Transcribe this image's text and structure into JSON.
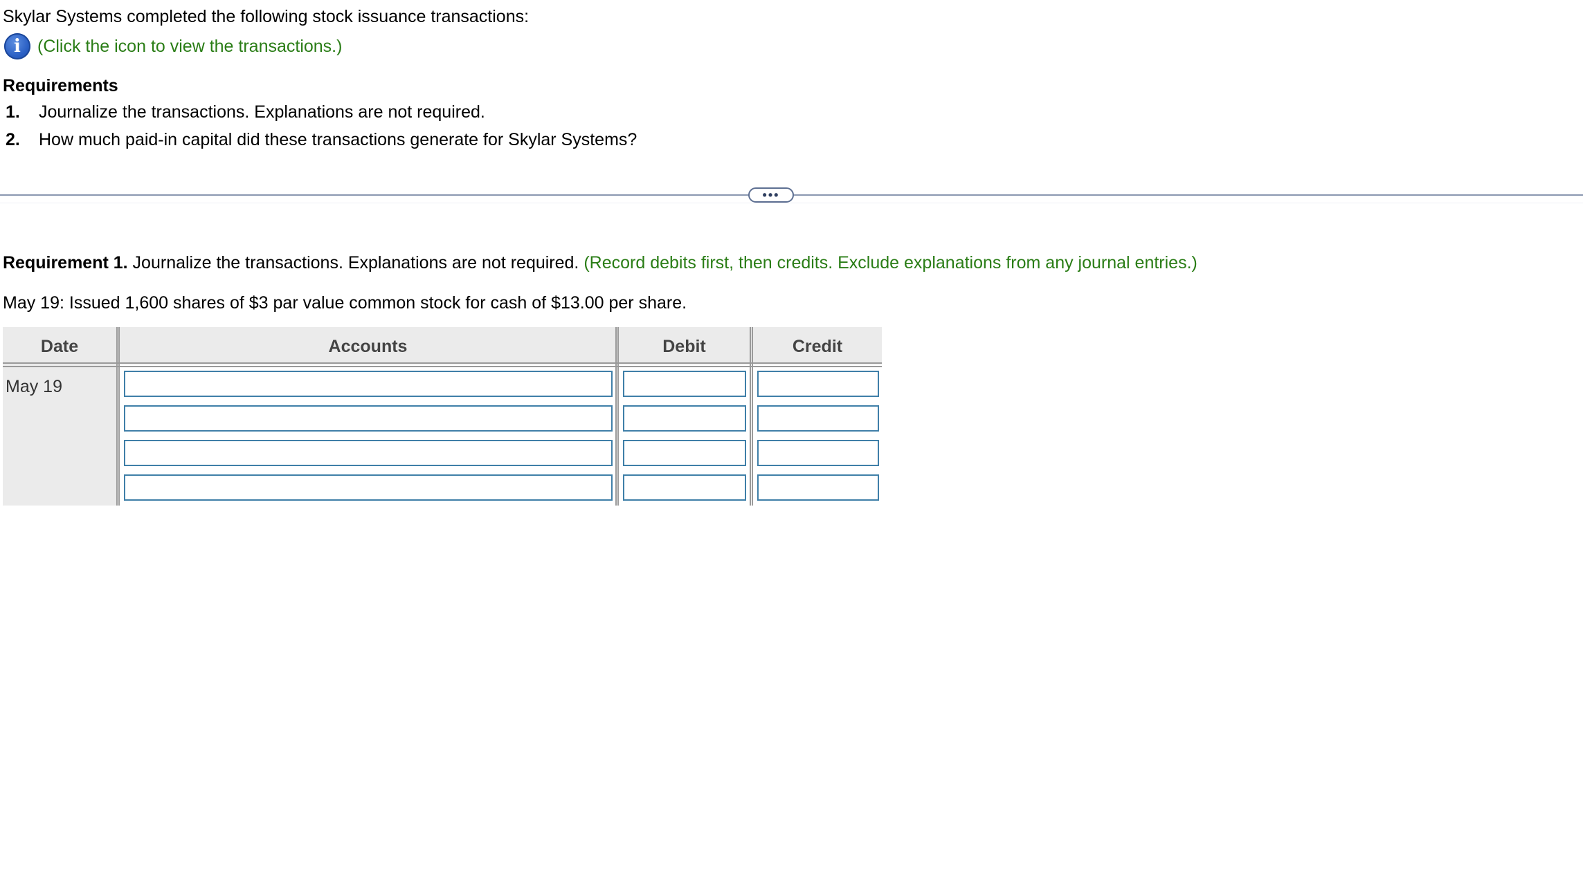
{
  "intro": {
    "text": "Skylar Systems completed the following stock issuance transactions:",
    "link_text": "(Click the icon to view the transactions.)"
  },
  "requirements": {
    "title": "Requirements",
    "items": [
      {
        "num": "1.",
        "text": "Journalize the transactions. Explanations are not required."
      },
      {
        "num": "2.",
        "text": "How much paid-in capital did these transactions generate for Skylar Systems?"
      }
    ]
  },
  "expand": {
    "label": "•••"
  },
  "requirement1": {
    "bold": "Requirement 1.",
    "text": " Journalize the transactions. Explanations are not required. ",
    "hint": "(Record debits first, then credits. Exclude explanations from any journal entries.)"
  },
  "transaction": {
    "text": "May 19: Issued 1,600 shares of $3 par value common stock for cash of $13.00 per share."
  },
  "journal": {
    "headers": {
      "date": "Date",
      "accounts": "Accounts",
      "debit": "Debit",
      "credit": "Credit"
    },
    "date": "May 19",
    "rows": [
      {
        "account": "",
        "debit": "",
        "credit": ""
      },
      {
        "account": "",
        "debit": "",
        "credit": ""
      },
      {
        "account": "",
        "debit": "",
        "credit": ""
      },
      {
        "account": "",
        "debit": "",
        "credit": ""
      }
    ]
  },
  "colors": {
    "hint_green": "#2a7d16",
    "input_border": "#3f7fa8",
    "table_bg": "#ebebeb",
    "info_icon_blue": "#2a5fc4"
  },
  "icons": {
    "info": "info-icon"
  }
}
